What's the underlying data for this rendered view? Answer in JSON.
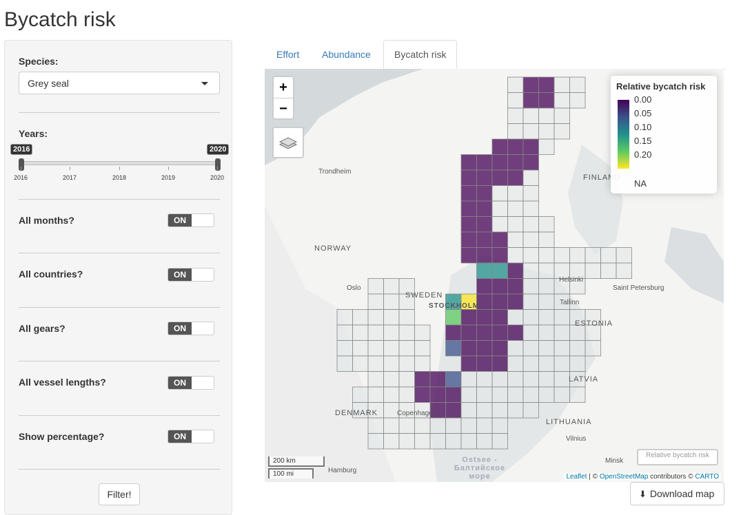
{
  "page_title": "Bycatch risk",
  "sidebar": {
    "species_label": "Species:",
    "species_value": "Grey seal",
    "years_label": "Years:",
    "years_from": "2016",
    "years_to": "2020",
    "year_ticks": [
      "2016",
      "2017",
      "2018",
      "2019",
      "2020"
    ],
    "toggles": [
      {
        "label": "All months?",
        "state": "ON"
      },
      {
        "label": "All countries?",
        "state": "ON"
      },
      {
        "label": "All gears?",
        "state": "ON"
      },
      {
        "label": "All vessel lengths?",
        "state": "ON"
      },
      {
        "label": "Show percentage?",
        "state": "ON"
      }
    ],
    "filter_button": "Filter!"
  },
  "tabs": [
    {
      "label": "Effort",
      "active": false
    },
    {
      "label": "Abundance",
      "active": false
    },
    {
      "label": "Bycatch risk",
      "active": true
    }
  ],
  "map": {
    "zoom_in": "+",
    "zoom_out": "−",
    "legend_title": "Relative bycatch risk",
    "legend_values": [
      "0.00",
      "0.05",
      "0.10",
      "0.15",
      "0.20"
    ],
    "legend_na": "NA",
    "scale_km": "200 km",
    "scale_mi": "100 mi",
    "attribution_leaflet": "Leaflet",
    "attribution_mid": " | © ",
    "attribution_osm": "OpenStreetMap",
    "attribution_contrib": " contributors © ",
    "attribution_carto": "CARTO",
    "layer_toggle_label": "Relative bycatch risk",
    "place_labels": [
      "NORWAY",
      "SWEDEN",
      "FINLAND",
      "ESTONIA",
      "LATVIA",
      "LITHUANIA",
      "DENMARK",
      "STOCKHOLM",
      "Trondheim",
      "Helsinki",
      "Saint Petersburg",
      "Tallinn",
      "Copenhagen",
      "Vilnius",
      "Minsk",
      "Hamburg",
      "Oslo",
      "Ostsee - Балтийское море"
    ],
    "colors": {
      "dark": "#440154",
      "mid": "#3b528b",
      "teal": "#21918c",
      "green": "#5ec962",
      "yellow": "#fde725"
    }
  },
  "download_button": "Download map"
}
